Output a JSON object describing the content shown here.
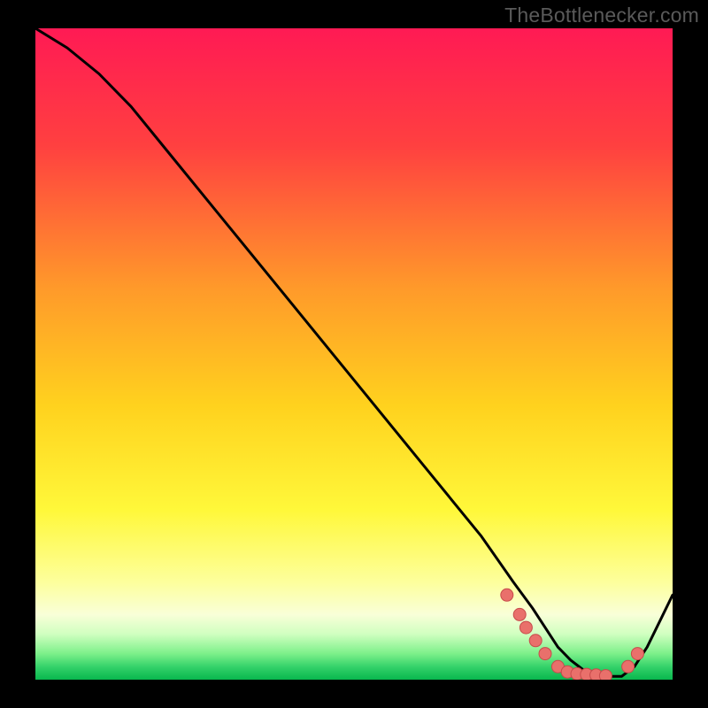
{
  "watermark": "TheBottlenecker.com",
  "colors": {
    "bg": "#000000",
    "watermark": "#5a5a5a",
    "curve": "#000000",
    "marker_fill": "#e9706b",
    "marker_stroke": "#c84b4b",
    "grad_top": "#ff1a54",
    "grad_mid1": "#ff7a2f",
    "grad_mid2": "#ffd21e",
    "grad_mid3": "#f7ff4a",
    "grad_low": "#fdffc8",
    "grad_green1": "#9cff9c",
    "grad_green2": "#35e06e",
    "grad_green3": "#08b74e"
  },
  "chart_data": {
    "type": "line",
    "title": "",
    "xlabel": "",
    "ylabel": "",
    "x_range": [
      0,
      100
    ],
    "y_range": [
      0,
      100
    ],
    "curve": {
      "x": [
        0,
        5,
        10,
        15,
        20,
        30,
        40,
        50,
        60,
        70,
        75,
        78,
        80,
        82,
        84,
        86,
        88,
        90,
        92,
        94,
        96,
        98,
        100
      ],
      "y": [
        100,
        97,
        93,
        88,
        82,
        70,
        58,
        46,
        34,
        22,
        15,
        11,
        8,
        5,
        3,
        1.5,
        0.8,
        0.5,
        0.5,
        2,
        5,
        9,
        13
      ]
    },
    "markers": {
      "x": [
        74,
        76,
        77,
        78.5,
        80,
        82,
        83.5,
        85,
        86.5,
        88,
        89.5,
        93,
        94.5
      ],
      "y": [
        13,
        10,
        8,
        6,
        4,
        2,
        1.2,
        0.9,
        0.8,
        0.7,
        0.6,
        2,
        4
      ]
    }
  }
}
